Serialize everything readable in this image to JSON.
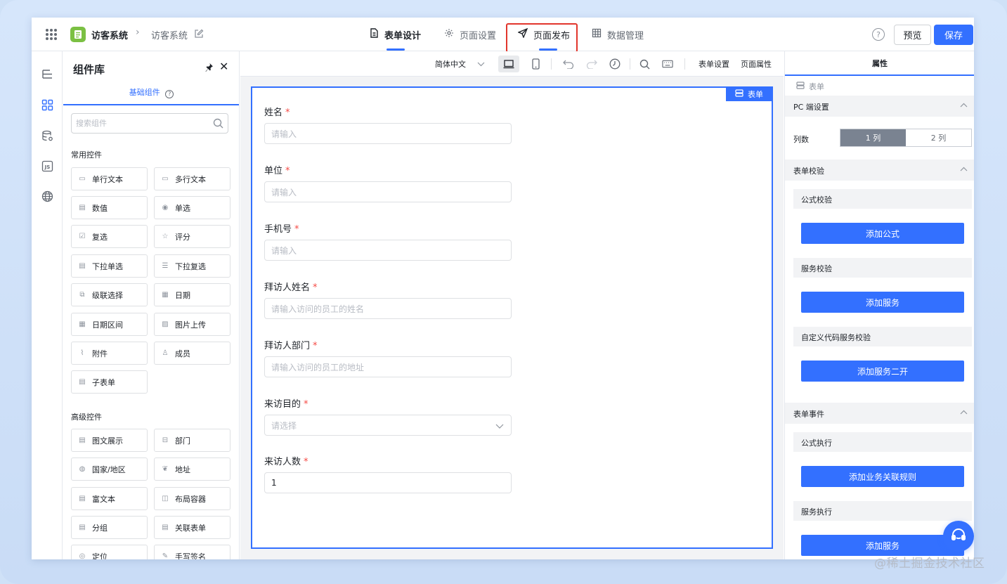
{
  "app": {
    "name": "访客系统",
    "page_name": "访客系统"
  },
  "nav": {
    "tabs": [
      {
        "label": "表单设计",
        "icon": "document-icon",
        "active": true
      },
      {
        "label": "页面设置",
        "icon": "gear-icon",
        "active": false
      },
      {
        "label": "页面发布",
        "icon": "send-icon",
        "active": false,
        "highlighted": true
      },
      {
        "label": "数据管理",
        "icon": "table-icon",
        "active": false
      }
    ],
    "preview_label": "预览",
    "save_label": "保存"
  },
  "rail": {
    "icons": [
      "outline-icon",
      "components-icon",
      "data-source-icon",
      "js-icon",
      "globe-icon"
    ],
    "js_text": "JS"
  },
  "library": {
    "title": "组件库",
    "tab_label": "基础组件",
    "search_placeholder": "搜索组件",
    "common_title": "常用控件",
    "common_items": [
      "单行文本",
      "多行文本",
      "数值",
      "单选",
      "复选",
      "评分",
      "下拉单选",
      "下拉复选",
      "级联选择",
      "日期",
      "日期区间",
      "图片上传",
      "附件",
      "成员",
      "子表单"
    ],
    "advanced_title": "高级控件",
    "advanced_items": [
      "图文展示",
      "部门",
      "国家/地区",
      "地址",
      "富文本",
      "布局容器",
      "分组",
      "关联表单",
      "定位",
      "手写签名"
    ]
  },
  "toolbar": {
    "language": "简体中文",
    "form_settings": "表单设置",
    "page_props": "页面属性"
  },
  "form": {
    "tag_label": "表单",
    "fields": [
      {
        "label": "姓名",
        "placeholder": "请输入",
        "value": "",
        "type": "text"
      },
      {
        "label": "单位",
        "placeholder": "请输入",
        "value": "",
        "type": "text"
      },
      {
        "label": "手机号",
        "placeholder": "请输入",
        "value": "",
        "type": "text"
      },
      {
        "label": "拜访人姓名",
        "placeholder": "请输入访问的员工的姓名",
        "value": "",
        "type": "text"
      },
      {
        "label": "拜访人部门",
        "placeholder": "请输入访问的员工的地址",
        "value": "",
        "type": "text"
      },
      {
        "label": "来访目的",
        "placeholder": "请选择",
        "value": "",
        "type": "select"
      },
      {
        "label": "来访人数",
        "placeholder": "",
        "value": "1",
        "type": "number"
      }
    ],
    "required_mark": "*"
  },
  "props": {
    "header": "属性",
    "breadcrumb": "表单",
    "pc_section": "PC 端设置",
    "columns_label": "列数",
    "columns_options": [
      "1 列",
      "2 列"
    ],
    "columns_selected": "1 列",
    "validation_section": "表单校验",
    "formula_validation": "公式校验",
    "add_formula": "添加公式",
    "service_validation": "服务校验",
    "add_service": "添加服务",
    "custom_validation": "自定义代码服务校验",
    "add_service_dev": "添加服务二开",
    "events_section": "表单事件",
    "formula_exec": "公式执行",
    "add_rule": "添加业务关联规则",
    "service_exec": "服务执行",
    "add_service_2": "添加服务"
  },
  "watermark": "@稀土掘金技术社区",
  "colors": {
    "accent": "#3370ff",
    "highlight_border": "#e2362c",
    "required": "#f54a45",
    "logo": "#7bc043"
  }
}
